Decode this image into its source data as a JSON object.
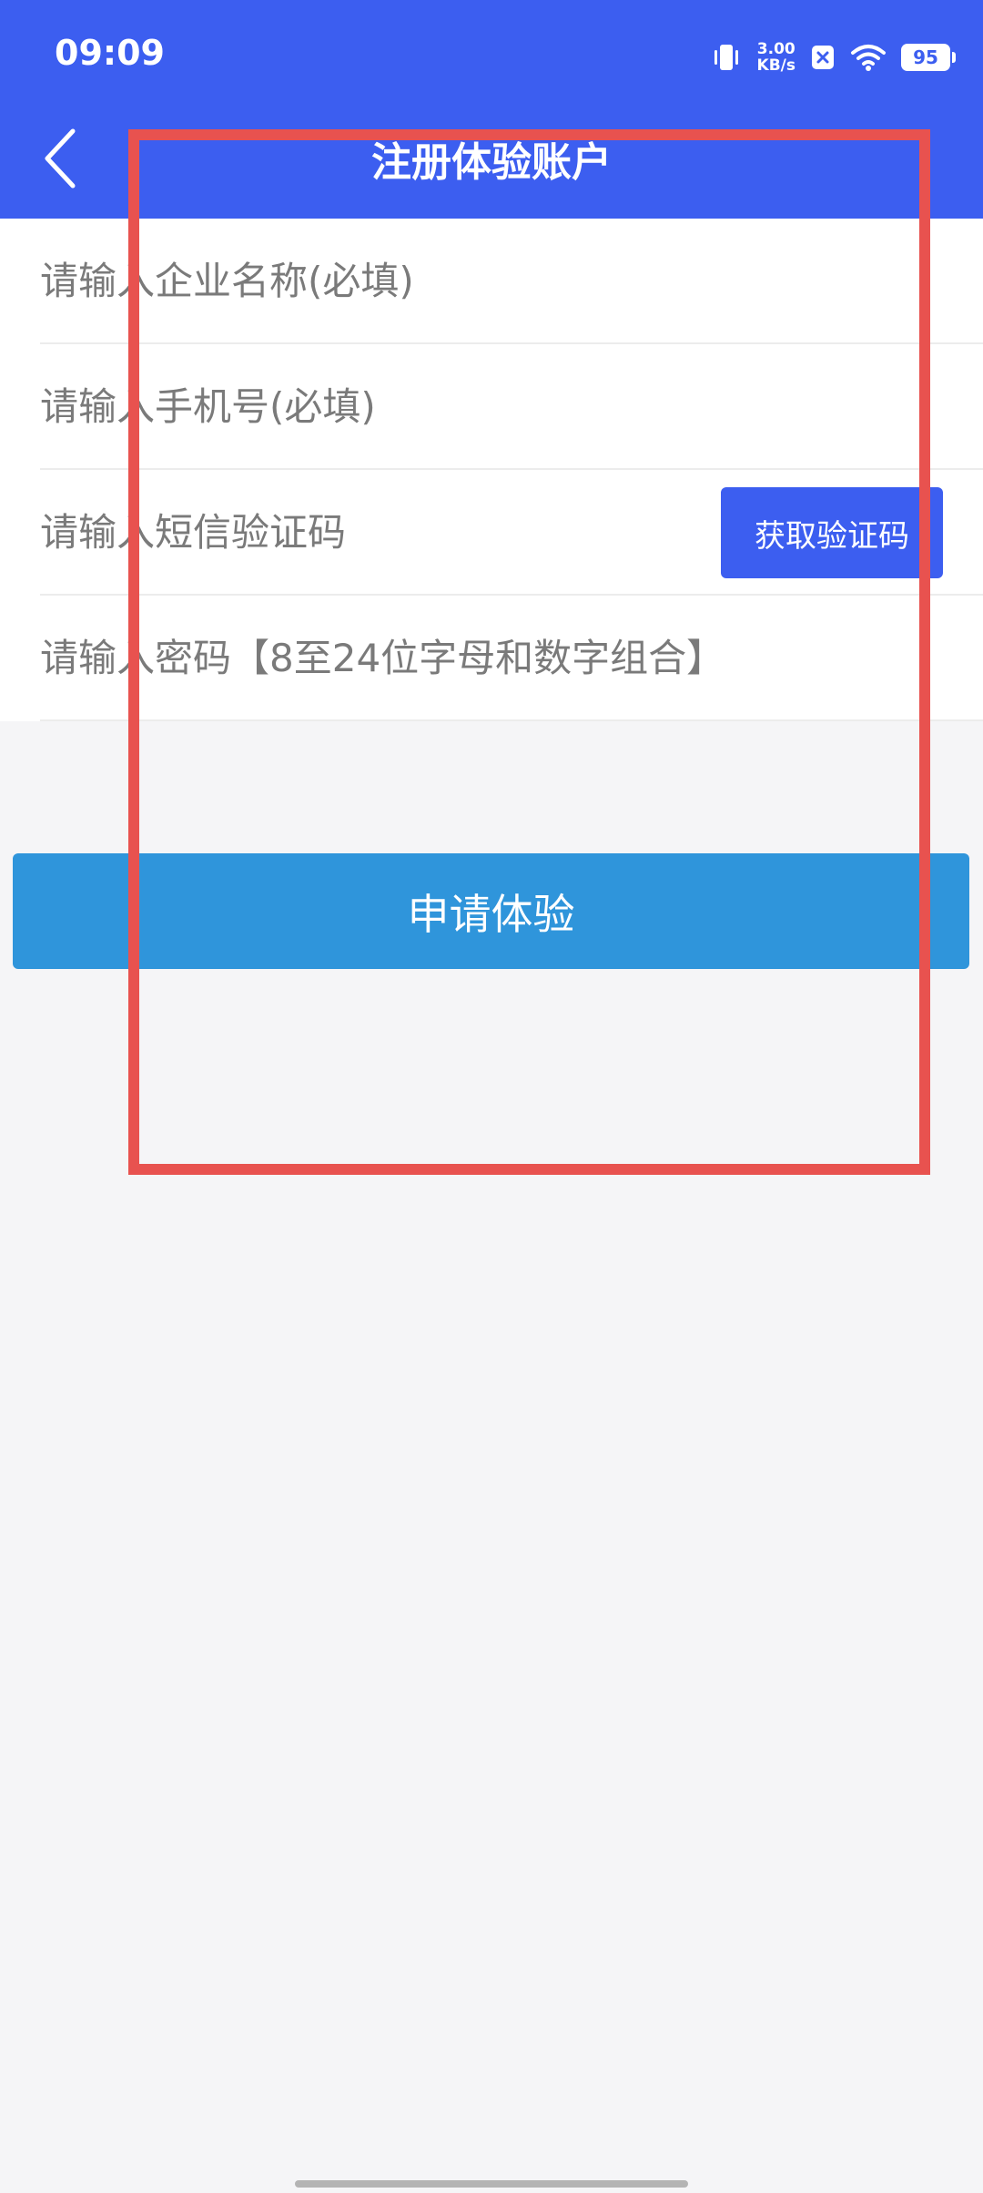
{
  "status_bar": {
    "time": "09:09",
    "network_speed_value": "3.00",
    "network_speed_unit": "KB/s",
    "battery": "95"
  },
  "header": {
    "title": "注册体验账户",
    "back_icon": "chevron-left-icon",
    "background_color": "#3c5ef0"
  },
  "form": {
    "company_placeholder": "请输入企业名称(必填)",
    "phone_placeholder": "请输入手机号(必填)",
    "sms_placeholder": "请输入短信验证码",
    "sms_button_label": "获取验证码",
    "password_placeholder": "请输入密码【8至24位字母和数字组合】"
  },
  "submit": {
    "label": "申请体验",
    "color": "#2f95db"
  },
  "annotation": {
    "highlight_color": "#e8524f"
  }
}
